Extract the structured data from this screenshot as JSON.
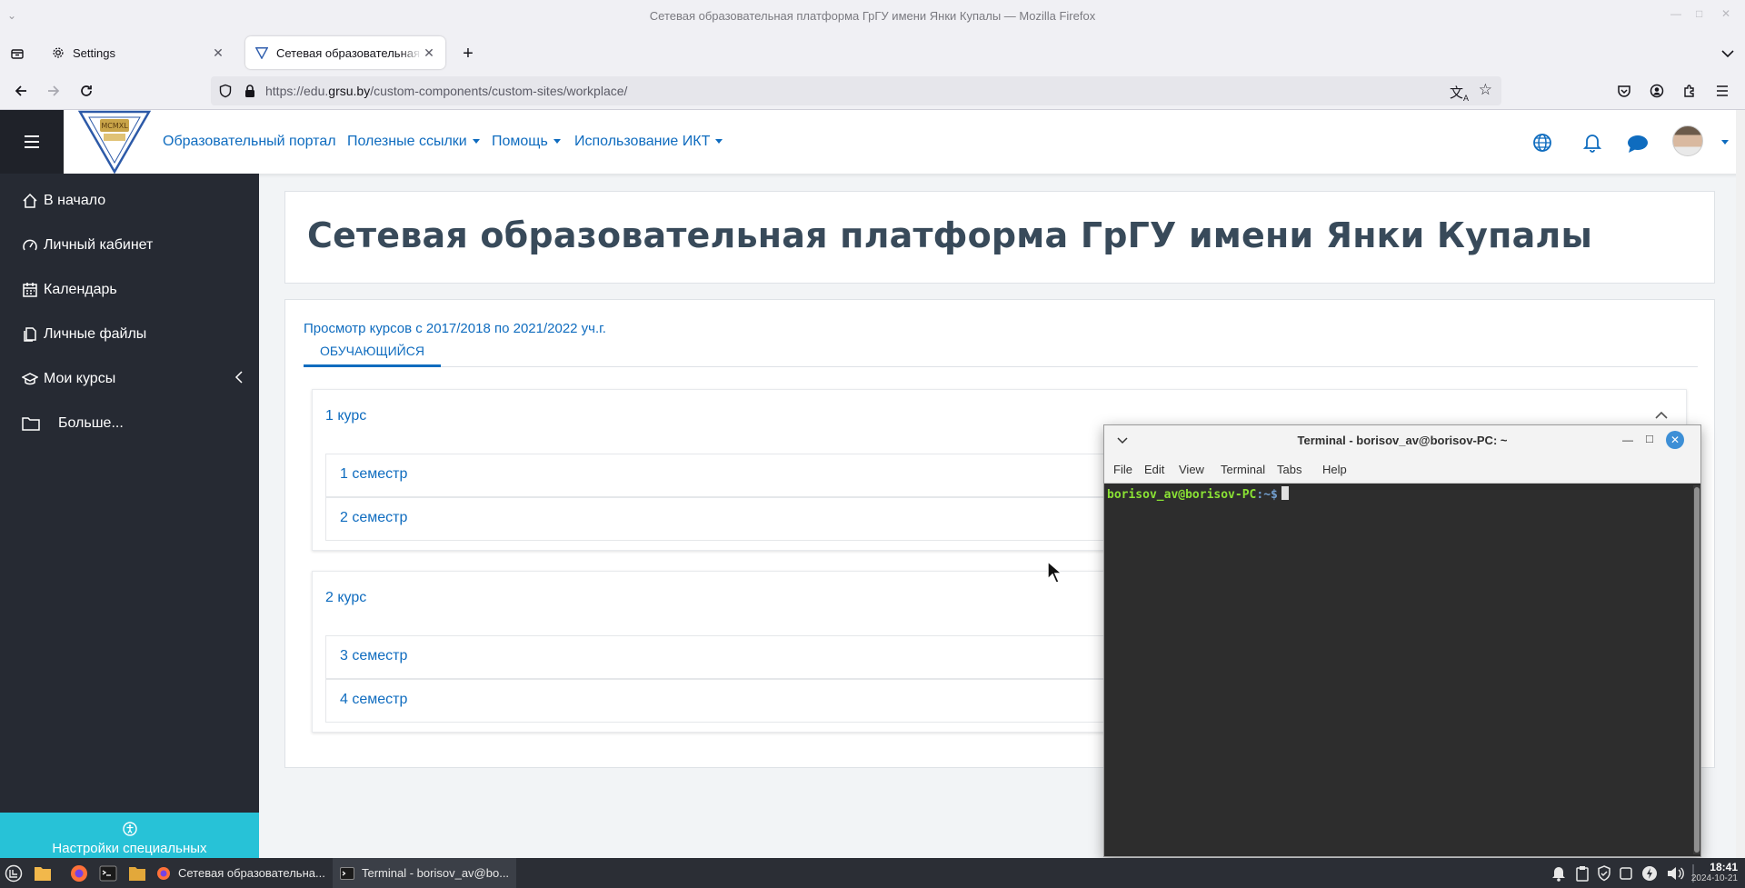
{
  "window": {
    "title": "Сетевая образовательная платформа ГрГУ имени Янки Купалы — Mozilla Firefox"
  },
  "tabs": [
    {
      "label": "Settings"
    },
    {
      "label": "Сетевая образовательная платформа ГрГУ имени Янки Купалы"
    }
  ],
  "urlbar": {
    "url_prefix": "https://edu.",
    "url_domain": "grsu.by",
    "url_path": "/custom-components/custom-sites/workplace/"
  },
  "header": {
    "logo_text": "MCMXL",
    "nav": [
      {
        "label": "Образовательный портал"
      },
      {
        "label": "Полезные ссылки"
      },
      {
        "label": "Помощь"
      },
      {
        "label": "Использование ИКТ"
      }
    ]
  },
  "drawer": {
    "items": [
      {
        "label": "В начало",
        "icon": "home-icon"
      },
      {
        "label": "Личный кабинет",
        "icon": "dashboard-icon"
      },
      {
        "label": "Календарь",
        "icon": "calendar-icon"
      },
      {
        "label": "Личные файлы",
        "icon": "files-icon"
      },
      {
        "label": "Мои курсы",
        "icon": "graduation-cap-icon"
      },
      {
        "label": "Больше...",
        "icon": "folder-icon"
      }
    ],
    "accessibility_label": "Настройки специальных"
  },
  "main": {
    "page_title": "Сетевая образовательная платформа ГрГУ имени Янки Купалы",
    "courses_link": "Просмотр курсов с 2017/2018 по 2021/2022 уч.г.",
    "tab_label": "ОБУЧАЮЩИЙСЯ",
    "years": [
      {
        "label": "1 курс",
        "semesters": [
          "1 семестр",
          "2 семестр"
        ]
      },
      {
        "label": "2 курс",
        "semesters": [
          "3 семестр",
          "4 семестр"
        ]
      }
    ]
  },
  "terminal": {
    "title": "Terminal - borisov_av@borisov-PC: ~",
    "menu": [
      "File",
      "Edit",
      "View",
      "Terminal",
      "Tabs",
      "Help"
    ],
    "prompt_user": "borisov_av@borisov-PC",
    "prompt_path": ":~$"
  },
  "taskbar": {
    "tasks": [
      {
        "label": "Сетевая образовательна..."
      },
      {
        "label": "Terminal - borisov_av@bo..."
      }
    ],
    "time": "18:41",
    "date": "2024-10-21"
  },
  "colors": {
    "link": "#0f6cbf",
    "drawer_bg": "#262a33",
    "accessibility_bg": "#27c2d7",
    "terminal_bg": "#2d2d2d",
    "prompt_green": "#8ae234"
  }
}
